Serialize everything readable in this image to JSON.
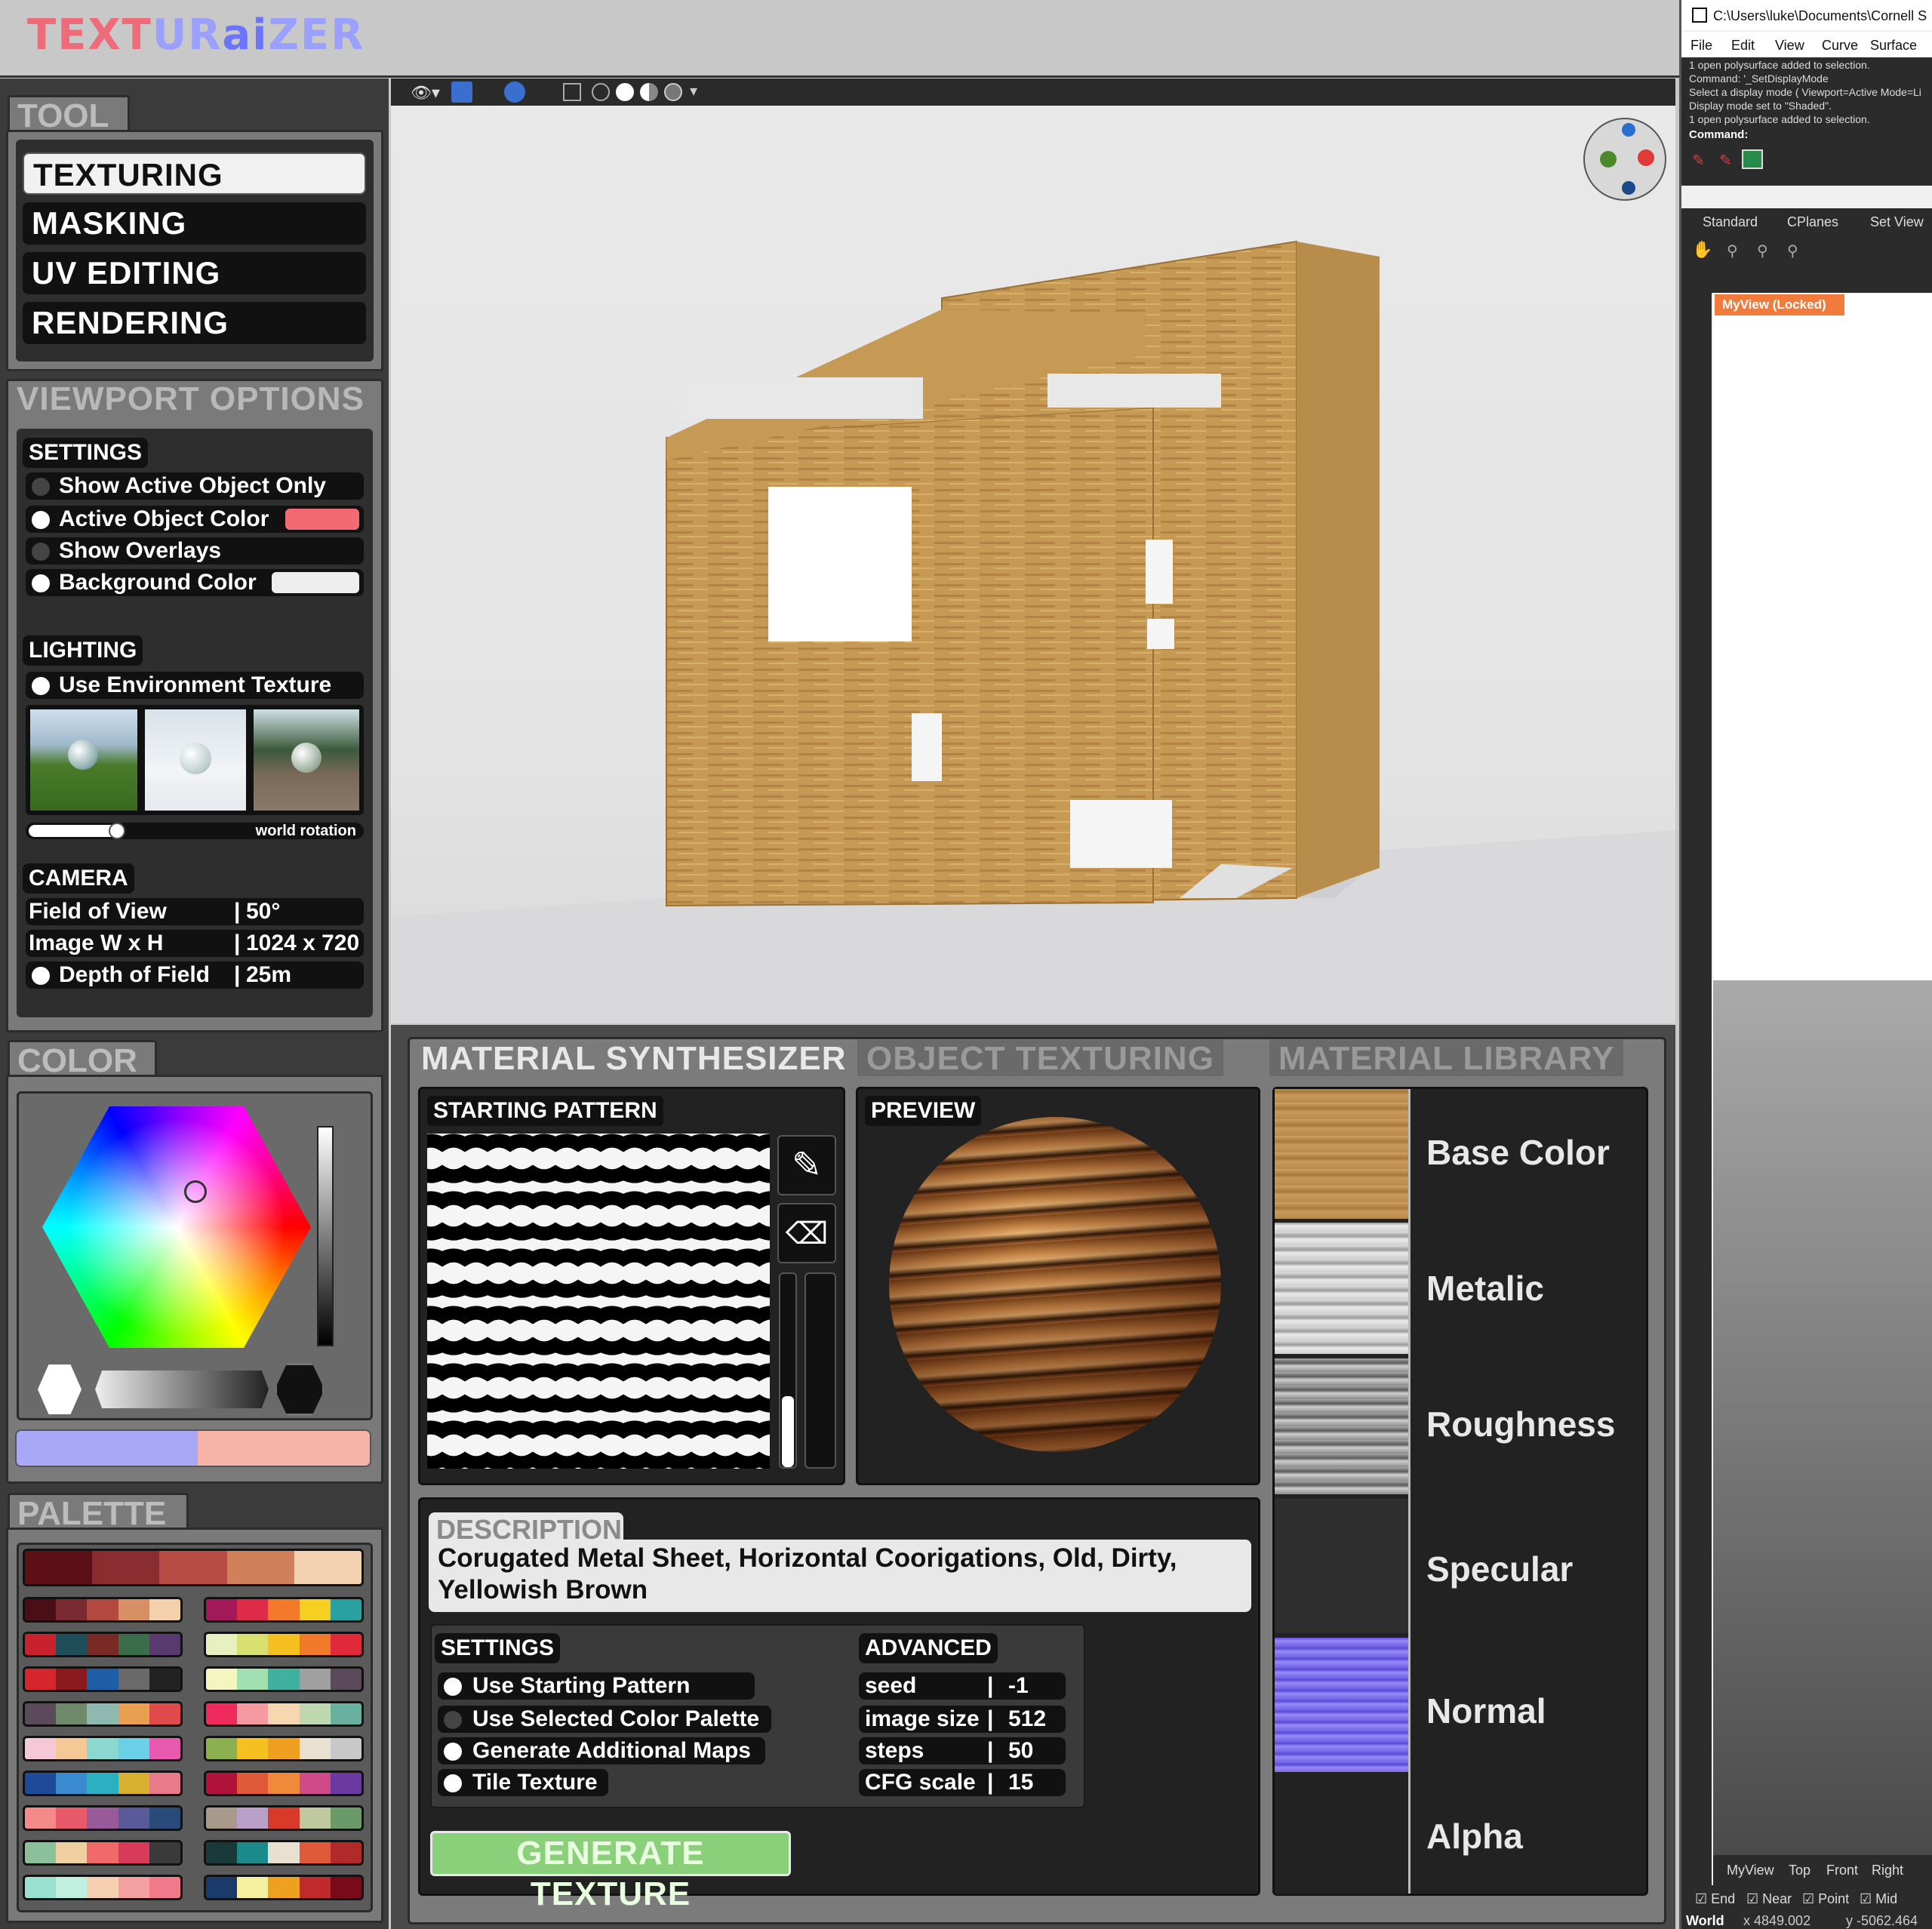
{
  "app": {
    "logo_a": "TEXT",
    "logo_b": "UR",
    "logo_c": "ai",
    "logo_d": "ZER"
  },
  "tool": {
    "title": "TOOL",
    "items": [
      "TEXTURING",
      "MASKING",
      "UV EDITING",
      "RENDERING"
    ],
    "active": "TEXTURING"
  },
  "viewport_options": {
    "title": "VIEWPORT OPTIONS",
    "settings_label": "SETTINGS",
    "settings": [
      "Show Active Object Only",
      "Active Object Color",
      "Show Overlays",
      "Background Color"
    ],
    "lighting_label": "LIGHTING",
    "use_env": "Use Environment Texture",
    "world_rotation": "world rotation",
    "camera_label": "CAMERA",
    "camera": [
      {
        "k": "Field of View",
        "v": "50°"
      },
      {
        "k": "Image W x H",
        "v": "1024 x 720"
      },
      {
        "k": "Depth of Field",
        "v": "25m"
      }
    ]
  },
  "color": {
    "title": "COLOR",
    "swatch_left": "#a9a8f6",
    "swatch_right": "#f6b3a8",
    "active_object_color": "#f26b73"
  },
  "palette": {
    "title": "PALETTE",
    "main": [
      "#5c0f16",
      "#8a2d31",
      "#b94b45",
      "#d0805a",
      "#f2d1b0"
    ],
    "left": [
      [
        "#4a0f14",
        "#7a2a30",
        "#b2483e",
        "#d98f64",
        "#f5d1ab"
      ],
      [
        "#c8232d",
        "#1f4e5a",
        "#7a2a25",
        "#3a6e4a",
        "#5a3a6e"
      ],
      [
        "#d6262c",
        "#8a1a1e",
        "#1e5ea6",
        "#6a6a6a",
        "#222"
      ],
      [
        "#5a4a5a",
        "#6e8a6a",
        "#8fb8b0",
        "#e8a050",
        "#e04a4a"
      ],
      [
        "#f5c8d8",
        "#f5c896",
        "#8ad8d0",
        "#6ad0e8",
        "#e85ab0"
      ],
      [
        "#1e4a9a",
        "#3a8ad0",
        "#2ab0c0",
        "#d8b030",
        "#e87a8a"
      ],
      [
        "#f58a8a",
        "#e85a6a",
        "#9a5a9a",
        "#5a5a9a",
        "#2a4a7a"
      ],
      [
        "#8ac09a",
        "#f0d0a0",
        "#f06a6a",
        "#d83a5a",
        "#3a3a3a"
      ],
      [
        "#9ae0d0",
        "#c0f0e0",
        "#f5d0b0",
        "#f5a0a0",
        "#f07a8a"
      ]
    ],
    "right": [
      [
        "#a2195a",
        "#e02a4a",
        "#f27a2a",
        "#f5d020",
        "#2aa0a0"
      ],
      [
        "#e8f0c0",
        "#d8e070",
        "#f5c020",
        "#f07a2a",
        "#e02a3a"
      ],
      [
        "#f5f5c0",
        "#a0e0b0",
        "#40b0a0",
        "#a0a0a0",
        "#5a4a5a"
      ],
      [
        "#f02a5a",
        "#f59aa0",
        "#f5d8b0",
        "#c0d8b0",
        "#6ab0a0"
      ],
      [
        "#8ab050",
        "#f5c020",
        "#f0a020",
        "#e8e0d0",
        "#c8c8c8"
      ],
      [
        "#b0123a",
        "#e05a3a",
        "#f08a3a",
        "#d04a8a",
        "#6a3aa0"
      ],
      [
        "#a89a8a",
        "#b8a0c8",
        "#d83a2a",
        "#c0c8a0",
        "#6a9a6a"
      ],
      [
        "#1a3a3a",
        "#1a8a8a",
        "#e8e0d0",
        "#e05a3a",
        "#b02a2a"
      ],
      [
        "#1a3a6a",
        "#f5f0a0",
        "#f0a020",
        "#c02a2a",
        "#7a0a1a"
      ]
    ]
  },
  "material": {
    "tabs": [
      "MATERIAL SYNTHESIZER",
      "OBJECT TEXTURING",
      "MATERIAL LIBRARY"
    ],
    "starting_pattern": "STARTING PATTERN",
    "preview": "PREVIEW",
    "maps": [
      "Base Color",
      "Metalic",
      "Roughness",
      "Specular",
      "Normal",
      "Alpha"
    ],
    "description_label": "DESCRIPTION",
    "description_line1": "Corugated Metal Sheet, Horizontal Coorigations, Old, Dirty,",
    "description_line2": "Yellowish Brown",
    "settings_label": "SETTINGS",
    "settings": [
      "Use Starting Pattern",
      "Use Selected Color Palette",
      "Generate Additional Maps",
      "Tile Texture"
    ],
    "advanced_label": "ADVANCED",
    "advanced": [
      {
        "k": "seed",
        "v": "-1"
      },
      {
        "k": "image size",
        "v": "512"
      },
      {
        "k": "steps",
        "v": "50"
      },
      {
        "k": "CFG scale",
        "v": "15"
      }
    ],
    "generate": "GENERATE TEXTURE"
  },
  "rhino": {
    "path": "C:\\Users\\luke\\Documents\\Cornell S",
    "menu": [
      "File",
      "Edit",
      "View",
      "Curve",
      "Surface"
    ],
    "log": [
      "1 open polysurface added to selection.",
      "Command: '_SetDisplayMode",
      "Select a display mode ( Viewport=Active  Mode=Li",
      "Display mode set to \"Shaded\".",
      "1 open polysurface added to selection."
    ],
    "command": "Command:",
    "tabs": [
      "Standard",
      "CPlanes",
      "Set View"
    ],
    "view_label": "MyView (Locked)",
    "view_tabs": [
      "MyView",
      "Top",
      "Front",
      "Right"
    ],
    "osnaps": [
      "End",
      "Near",
      "Point",
      "Mid"
    ],
    "status_world": "World",
    "status_x": "x 4849.002",
    "status_y": "y -5062.464"
  }
}
